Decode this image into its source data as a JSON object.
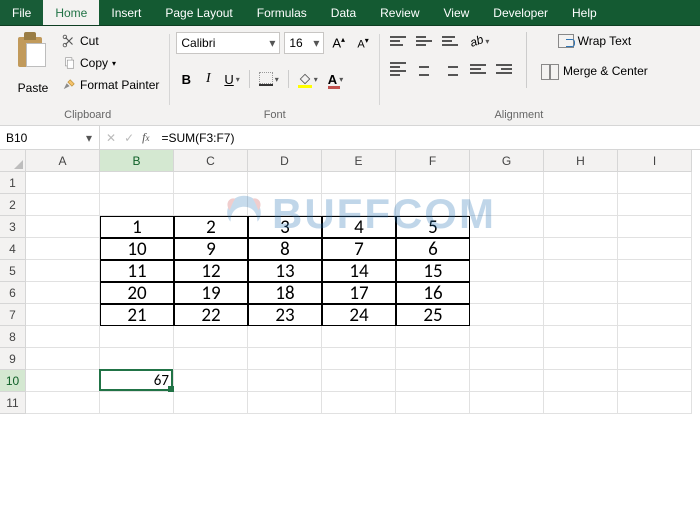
{
  "tabs": {
    "file": "File",
    "list": [
      "Home",
      "Insert",
      "Page Layout",
      "Formulas",
      "Data",
      "Review",
      "View",
      "Developer",
      "Help"
    ],
    "active_index": 0
  },
  "ribbon": {
    "clipboard": {
      "label": "Clipboard",
      "paste": "Paste",
      "cut": "Cut",
      "copy": "Copy",
      "format_painter": "Format Painter"
    },
    "font": {
      "label": "Font",
      "name": "Calibri",
      "size": "16",
      "bold": "B",
      "italic": "I",
      "underline": "U",
      "grow": "A",
      "shrink": "A"
    },
    "alignment": {
      "label": "Alignment",
      "wrap": "Wrap Text",
      "merge": "Merge & Center"
    }
  },
  "formula_bar": {
    "cell_ref": "B10",
    "formula": "=SUM(F3:F7)"
  },
  "grid": {
    "columns": [
      "A",
      "B",
      "C",
      "D",
      "E",
      "F",
      "G",
      "H",
      "I"
    ],
    "row_count": 11,
    "data_start_row": 3,
    "data_start_col": 2,
    "data": [
      [
        1,
        2,
        3,
        4,
        5
      ],
      [
        10,
        9,
        8,
        7,
        6
      ],
      [
        11,
        12,
        13,
        14,
        15
      ],
      [
        20,
        19,
        18,
        17,
        16
      ],
      [
        21,
        22,
        23,
        24,
        25
      ]
    ],
    "result_cell": {
      "row": 10,
      "col": 2,
      "value": 67
    },
    "active": {
      "row": 10,
      "col": 2
    }
  },
  "watermark": "BUFFCOM"
}
